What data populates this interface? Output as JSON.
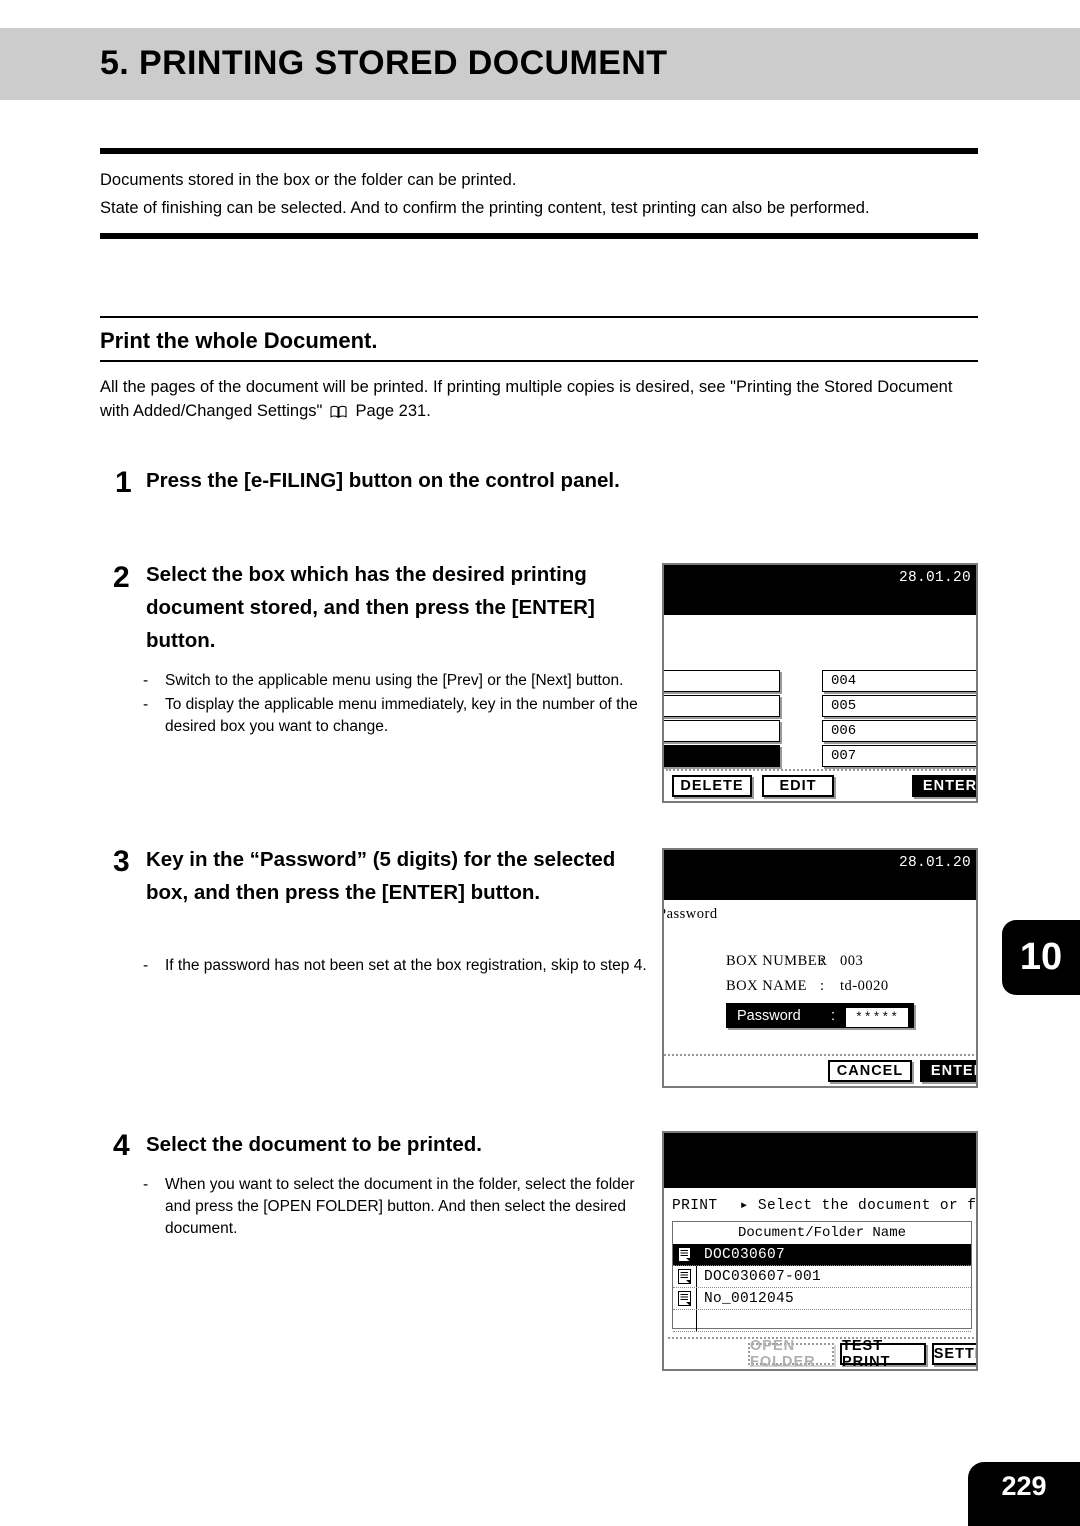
{
  "header": {
    "title": "5. PRINTING STORED DOCUMENT"
  },
  "intro": {
    "line1": "Documents stored in the box or the folder can be printed.",
    "line2": "State of finishing can be selected. And to confirm the printing content, test printing can also be performed."
  },
  "section": {
    "heading": "Print the whole Document.",
    "body_part1": "All the pages of the document will be printed. If printing multiple copies is desired, see \"Printing the Stored Document with Added/Changed Settings\"",
    "body_part2": "Page 231.",
    "book_icon": "open-book-icon"
  },
  "steps": [
    {
      "number": "1",
      "title": "Press the [e-FILING] button on the control panel.",
      "bullets": []
    },
    {
      "number": "2",
      "title": "Select the box which has the desired printing document stored, and then press the [ENTER] button.",
      "bullets": [
        "Switch to the applicable menu using the [Prev] or the [Next] button.",
        "To display the applicable menu immediately, key in the number of the desired box you want to change."
      ]
    },
    {
      "number": "3",
      "title": "Key in the “Password” (5 digits) for the selected box, and then press the [ENTER] button.",
      "bullets": [
        "If the password has not been set at the box registration, skip to step 4."
      ]
    },
    {
      "number": "4",
      "title": "Select the document to be printed.",
      "bullets": [
        "When you want to select the document in the folder, select the folder and press the [OPEN FOLDER] button. And then select the desired document."
      ]
    }
  ],
  "screen_box_list": {
    "date": "28.01.20",
    "left_rows": [
      "",
      "",
      "",
      ""
    ],
    "left_selected_index": 3,
    "right_rows": [
      "004",
      "005",
      "006",
      "007"
    ],
    "buttons": {
      "delete": "DELETE",
      "edit": "EDIT",
      "enter": "ENTER"
    }
  },
  "screen_password": {
    "date": "28.01.20",
    "screen_label": "Password",
    "fields": [
      {
        "label": "BOX NUMBER",
        "colon": ":",
        "value": "003"
      },
      {
        "label": "BOX NAME",
        "colon": ":",
        "value": "td-0020"
      }
    ],
    "password_field": {
      "label": "Password",
      "colon": ":",
      "value": "*****"
    },
    "buttons": {
      "cancel": "CANCEL",
      "enter": "ENTER"
    }
  },
  "screen_document_list": {
    "status_mode": "PRINT",
    "status_arrow": "▸",
    "status_message": "Select the document or folder",
    "column_header": "Document/Folder Name",
    "rows": [
      {
        "name": "DOC030607",
        "icon": "document-icon",
        "selected": true
      },
      {
        "name": "DOC030607-001",
        "icon": "document-icon",
        "selected": false
      },
      {
        "name": "No_0012045",
        "icon": "document-icon",
        "selected": false
      }
    ],
    "empty_rows": 2,
    "buttons": {
      "open_folder": "OPEN FOLDER",
      "open_folder_disabled": true,
      "test_print": "TEST PRINT",
      "settings": "SETTINGS"
    }
  },
  "chapter_tab": "10",
  "page_number": "229",
  "colors": {
    "header_band": "#cccccc",
    "ink": "#000000",
    "lcd_border": "#7a7a7a",
    "disabled": "#b0b0b0"
  }
}
